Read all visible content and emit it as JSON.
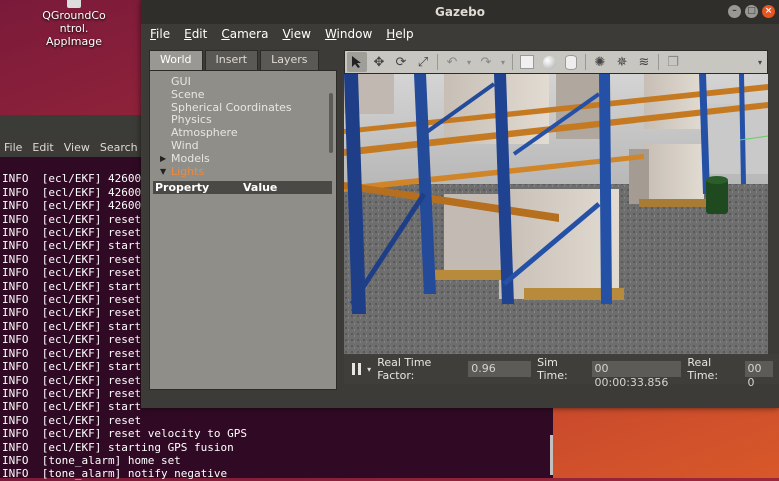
{
  "desktop": {
    "icon_label_line1": "QGroundCo",
    "icon_label_line2": "ntrol.",
    "icon_label_line3": "AppImage"
  },
  "terminal": {
    "menu": [
      "File",
      "Edit",
      "View",
      "Search",
      "T"
    ],
    "lines": [
      "INFO  [ecl/EKF] 42600",
      "INFO  [ecl/EKF] 42600",
      "INFO  [ecl/EKF] 42600",
      "INFO  [ecl/EKF] reset",
      "INFO  [ecl/EKF] reset",
      "INFO  [ecl/EKF] start",
      "INFO  [ecl/EKF] reset",
      "INFO  [ecl/EKF] reset",
      "INFO  [ecl/EKF] start",
      "INFO  [ecl/EKF] reset",
      "INFO  [ecl/EKF] reset",
      "INFO  [ecl/EKF] start",
      "INFO  [ecl/EKF] reset",
      "INFO  [ecl/EKF] reset",
      "INFO  [ecl/EKF] start",
      "INFO  [ecl/EKF] reset",
      "INFO  [ecl/EKF] reset",
      "INFO  [ecl/EKF] start",
      "INFO  [ecl/EKF] reset",
      "INFO  [ecl/EKF] reset velocity to GPS",
      "INFO  [ecl/EKF] starting GPS fusion",
      "INFO  [tone_alarm] home set",
      "INFO  [tone_alarm] notify negative"
    ]
  },
  "gazebo": {
    "title": "Gazebo",
    "menu": [
      "File",
      "Edit",
      "Camera",
      "View",
      "Window",
      "Help"
    ],
    "tabs": [
      "World",
      "Insert",
      "Layers"
    ],
    "tree": [
      "GUI",
      "Scene",
      "Spherical Coordinates",
      "Physics",
      "Atmosphere",
      "Wind",
      "Models",
      "Lights"
    ],
    "props_header": {
      "property": "Property",
      "value": "Value"
    },
    "bottom": {
      "rtf_label": "Real Time Factor:",
      "rtf_value": "0.96",
      "sim_label": "Sim Time:",
      "sim_value": "00 00:00:33.856",
      "real_label": "Real Time:",
      "real_value": "00 0"
    },
    "toolbar_icons": [
      "select-arrow",
      "translate",
      "rotate",
      "scale",
      "undo",
      "undo-dropdown",
      "redo",
      "redo-dropdown",
      "box",
      "sphere",
      "cylinder",
      "point-light",
      "spot-light",
      "directional-light",
      "copy",
      "more"
    ]
  }
}
